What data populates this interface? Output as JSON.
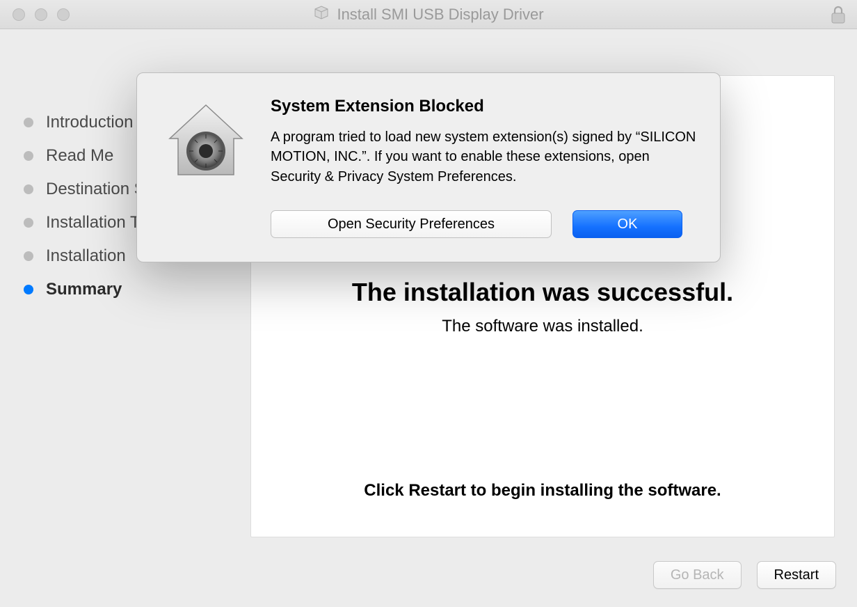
{
  "window": {
    "title": "Install SMI USB Display Driver"
  },
  "sidebar": {
    "steps": [
      {
        "label": "Introduction",
        "active": false
      },
      {
        "label": "Read Me",
        "active": false
      },
      {
        "label": "Destination Select",
        "active": false
      },
      {
        "label": "Installation Type",
        "active": false
      },
      {
        "label": "Installation",
        "active": false
      },
      {
        "label": "Summary",
        "active": true
      }
    ]
  },
  "content": {
    "success_title": "The installation was successful.",
    "success_sub": "The software was installed.",
    "restart_hint": "Click Restart to begin installing the software."
  },
  "footer": {
    "go_back": "Go Back",
    "restart": "Restart"
  },
  "sheet": {
    "title": "System Extension Blocked",
    "body": "A program tried to load new system extension(s) signed by “SILICON MOTION, INC.”.  If you want to enable these extensions, open Security & Privacy System Preferences.",
    "open_prefs": "Open Security Preferences",
    "ok": "OK"
  }
}
